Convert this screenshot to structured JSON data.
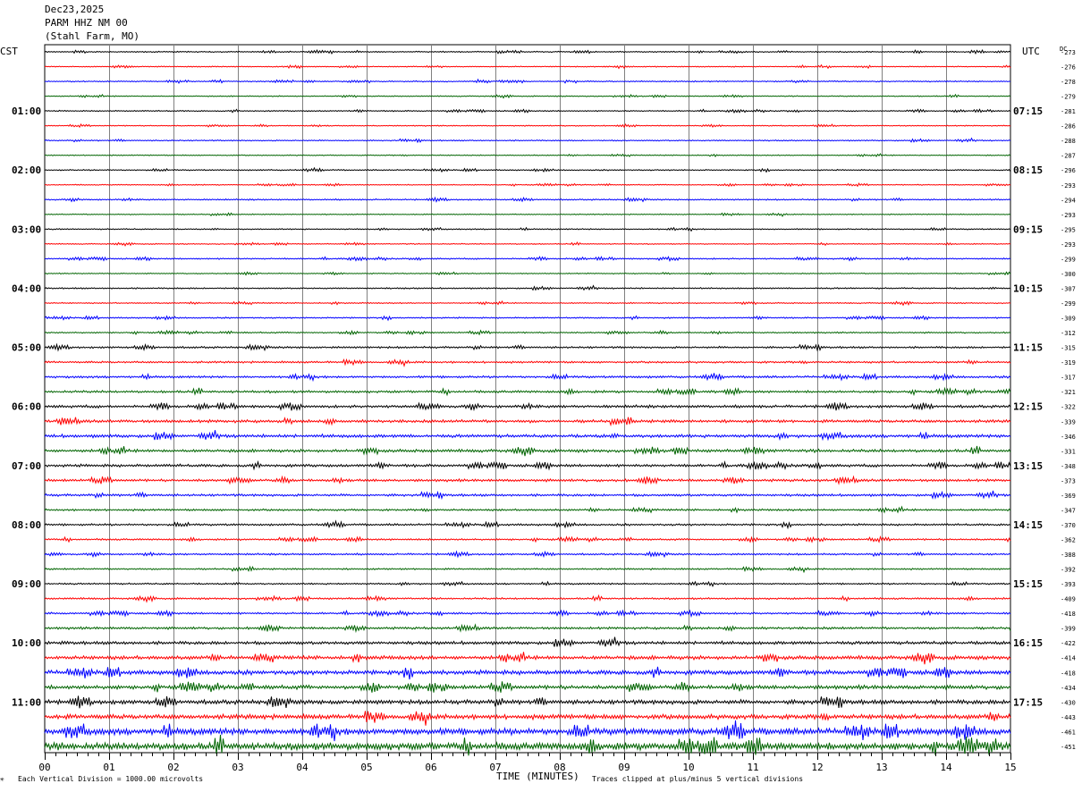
{
  "header": {
    "date": "Dec23,2025",
    "station": "PARM HHZ NM 00",
    "location": "(Stahl Farm, MO)"
  },
  "left_label": "CST",
  "right_label": "UTC",
  "dc_label": "DC",
  "xlabel": "TIME (MINUTES)",
  "footer_left": "Each Vertical Division = 1000.00 microvolts",
  "footer_right": "Traces clipped at plus/minus 5 vertical divisions",
  "corner_mark": "✳",
  "trace_colors": [
    "#000000",
    "#ff0000",
    "#0000ff",
    "#006400"
  ],
  "chart_data": {
    "type": "line",
    "title": "Dec23,2025 PARM HHZ NM 00 (Stahl Farm, MO)",
    "xlabel": "TIME (MINUTES)",
    "x_ticks": [
      "00",
      "01",
      "02",
      "03",
      "04",
      "05",
      "06",
      "07",
      "08",
      "09",
      "10",
      "11",
      "12",
      "13",
      "14",
      "15"
    ],
    "xlim": [
      0,
      15
    ],
    "grid": true,
    "left_time_labels": [
      "01:00",
      "02:00",
      "03:00",
      "04:00",
      "05:00",
      "06:00",
      "07:00",
      "08:00",
      "09:00",
      "10:00",
      "11:00"
    ],
    "right_time_labels": [
      "07:15",
      "08:15",
      "09:15",
      "10:15",
      "11:15",
      "12:15",
      "13:15",
      "14:15",
      "15:15",
      "16:15",
      "17:15"
    ],
    "dc_offsets": [
      -273,
      -276,
      -278,
      -279,
      -281,
      -286,
      -288,
      -287,
      -296,
      -293,
      -294,
      -293,
      -295,
      -293,
      -299,
      -300,
      -307,
      -299,
      -309,
      -312,
      -315,
      -319,
      -317,
      -321,
      -322,
      -339,
      -346,
      -331,
      -348,
      -373,
      -369,
      -347,
      -370,
      -362,
      -388,
      -392,
      -393,
      -409,
      -418,
      -399,
      -422,
      -414,
      -418,
      -434,
      -430,
      -443,
      -461,
      -451
    ],
    "amplitude_levels": [
      0.6,
      0.5,
      0.6,
      0.5,
      0.6,
      0.5,
      0.6,
      0.5,
      0.6,
      0.5,
      0.7,
      0.5,
      0.6,
      0.5,
      0.7,
      0.5,
      0.7,
      0.6,
      0.7,
      0.7,
      1.0,
      1.0,
      1.1,
      1.2,
      1.4,
      1.5,
      1.6,
      1.5,
      1.4,
      1.3,
      1.2,
      1.0,
      1.0,
      0.9,
      0.9,
      0.8,
      0.8,
      0.9,
      1.0,
      1.2,
      1.6,
      1.9,
      2.2,
      2.0,
      2.2,
      2.4,
      3.2,
      3.6
    ],
    "scale": "Each Vertical Division = 1000.00 microvolts",
    "clip": "Traces clipped at plus/minus 5 vertical divisions"
  }
}
